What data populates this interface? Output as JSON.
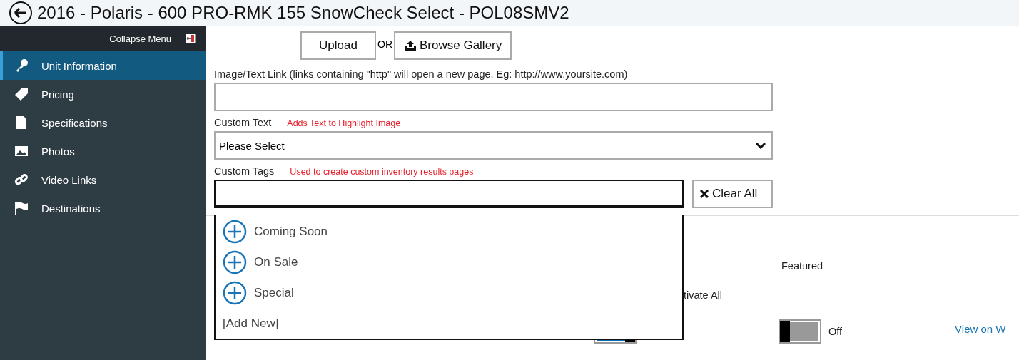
{
  "header": {
    "title": "2016 - Polaris - 600 PRO-RMK 155 SnowCheck Select - POL08SMV2"
  },
  "sidebar": {
    "collapse_label": "Collapse Menu",
    "items": [
      {
        "label": "Unit Information",
        "selected": true
      },
      {
        "label": "Pricing",
        "selected": false
      },
      {
        "label": "Specifications",
        "selected": false
      },
      {
        "label": "Photos",
        "selected": false
      },
      {
        "label": "Video Links",
        "selected": false
      },
      {
        "label": "Destinations",
        "selected": false
      }
    ]
  },
  "upload": {
    "upload_button": "Upload",
    "or": "OR",
    "browse_button": "Browse Gallery"
  },
  "link_field": {
    "label": "Image/Text Link (links containing \"http\" will open a new page. Eg: http://www.yoursite.com)"
  },
  "custom_text": {
    "label": "Custom Text",
    "hint": "Adds Text to Highlight Image",
    "value": "Please Select"
  },
  "custom_tags": {
    "label": "Custom Tags",
    "hint": "Used to create custom inventory results pages",
    "clear_button": "Clear All",
    "options": [
      {
        "label": "Coming Soon",
        "kind": "tag"
      },
      {
        "label": "On Sale",
        "kind": "tag"
      },
      {
        "label": "Special",
        "kind": "tag"
      },
      {
        "label": "[Add New]",
        "kind": "add"
      }
    ]
  },
  "settings": {
    "featured_label": "Featured",
    "activate_label": "tivate All",
    "toggles": [
      {
        "on": true
      },
      {
        "on": false,
        "reading": "Off"
      }
    ],
    "view_link": "View on W"
  }
}
